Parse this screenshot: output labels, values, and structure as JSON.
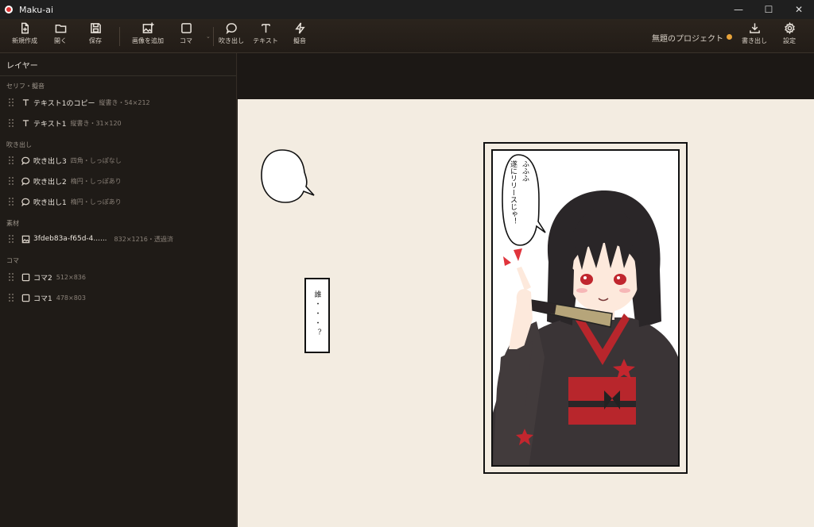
{
  "window": {
    "title": "Maku-ai",
    "controls": [
      "—",
      "☐",
      "✕"
    ]
  },
  "toolbar": {
    "new_label": "新規作成",
    "open_label": "開く",
    "save_label": "保存",
    "add_image_label": "画像を追加",
    "panel_label": "コマ",
    "bubble_label": "吹き出し",
    "text_label": "テキスト",
    "sfx_label": "擬音",
    "project_name": "無題のプロジェクト",
    "export_label": "書き出し",
    "settings_label": "設定"
  },
  "sidebar": {
    "title": "レイヤー",
    "groups": {
      "text": "セリフ・擬音",
      "bubbles": "吹き出し",
      "materials": "素材",
      "panels": "コマ"
    },
    "layers": [
      {
        "name": "テキスト1のコピー",
        "meta": "縦書き・54×212",
        "icon": "text-icon"
      },
      {
        "name": "テキスト1",
        "meta": "縦書き・31×120",
        "icon": "text-icon"
      },
      {
        "name": "吹き出し3",
        "meta": "四角・しっぽなし",
        "icon": "speech-bubble-icon"
      },
      {
        "name": "吹き出し2",
        "meta": "楕円・しっぽあり",
        "icon": "speech-bubble-icon"
      },
      {
        "name": "吹き出し1",
        "meta": "楕円・しっぽあり",
        "icon": "speech-bubble-icon"
      },
      {
        "name": "3fdeb83a-f65d-4......",
        "meta": "832×1216・透過済",
        "icon": "image-icon"
      },
      {
        "name": "コマ2",
        "meta": "512×836",
        "icon": "square-icon"
      },
      {
        "name": "コマ1",
        "meta": "478×803",
        "icon": "square-icon"
      }
    ]
  },
  "canvas": {
    "vertical_text_box": "誰・・・？",
    "speech_lines": [
      "ふふふ",
      "遂にリリースじゃ！"
    ]
  },
  "colors": {
    "accent_dot": "#e8a33a",
    "page_bg": "#f3ece1",
    "sidebar_bg": "#1f1b17"
  }
}
